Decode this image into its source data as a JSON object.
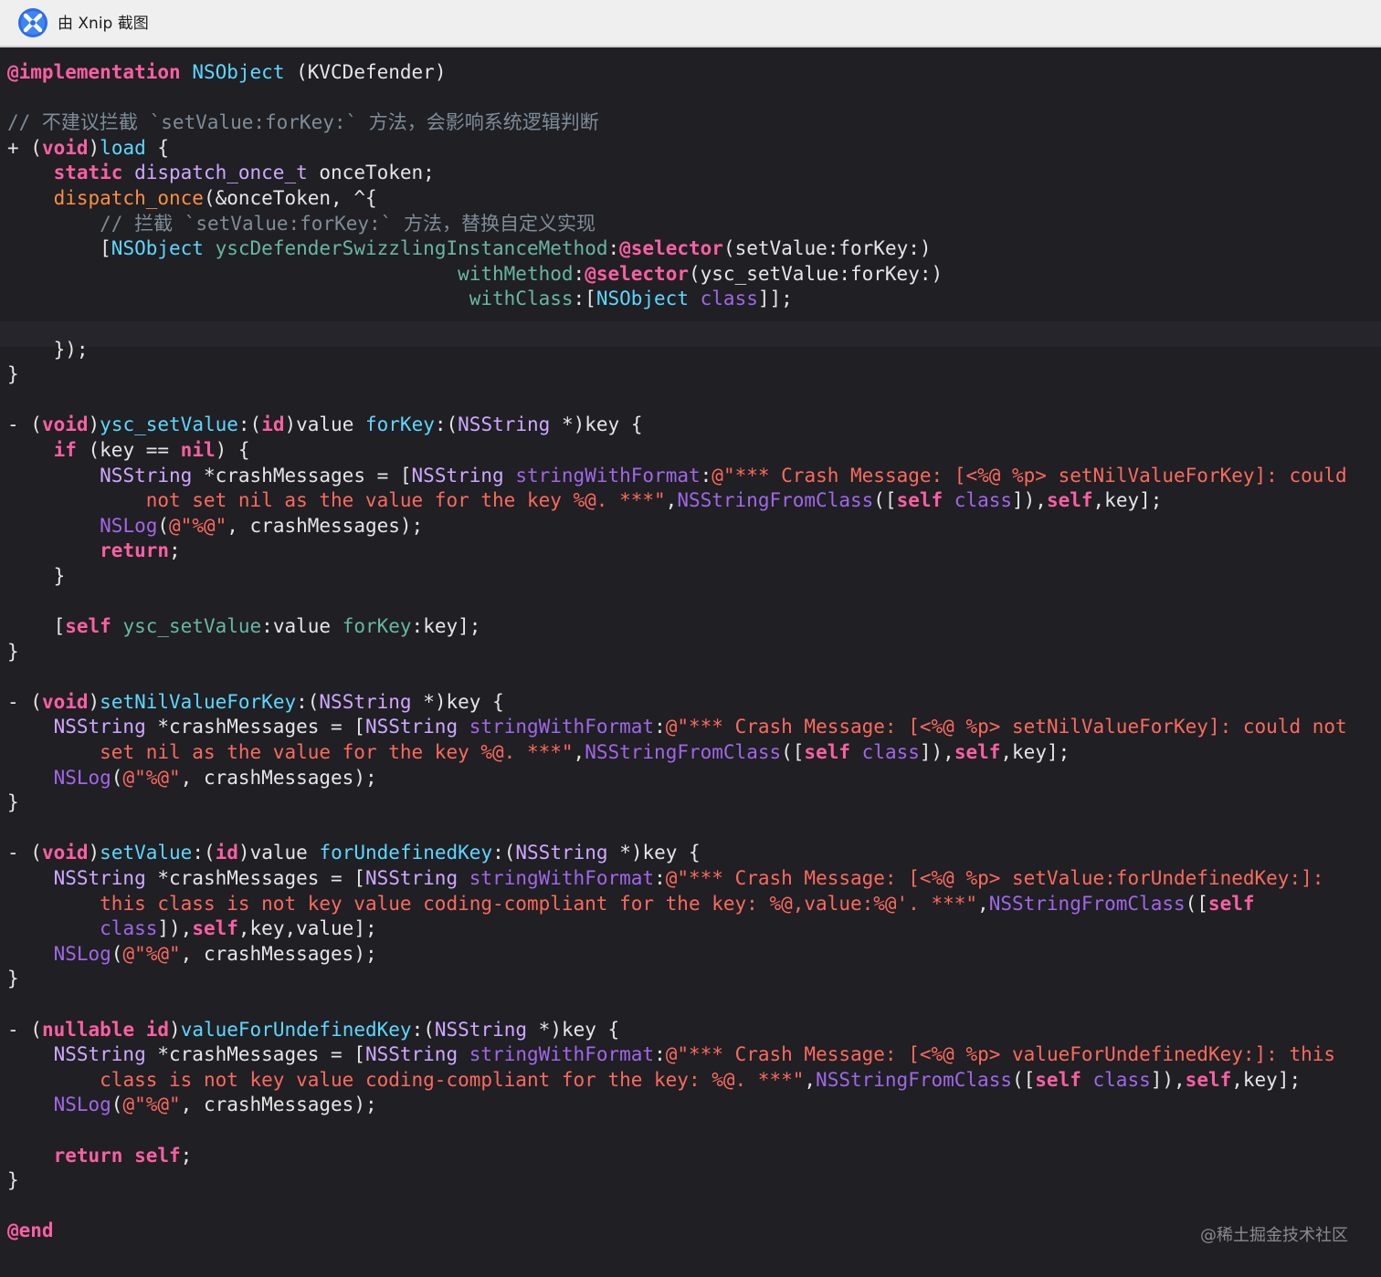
{
  "window": {
    "title": "由 Xnip 截图",
    "app_icon": "xnip-app-icon"
  },
  "editor": {
    "highlighted_line": 12,
    "lines": [
      [
        {
          "t": "@implementation",
          "c": "kw"
        },
        {
          "t": " "
        },
        {
          "t": "NSObject",
          "c": "ty"
        },
        {
          "t": " (KVCDefender)"
        }
      ],
      [],
      [
        {
          "t": "// 不建议拦截 `setValue:forKey:` 方法，会影响系统逻辑判断",
          "c": "cmt"
        }
      ],
      [
        {
          "t": "+ ("
        },
        {
          "t": "void",
          "c": "kw"
        },
        {
          "t": ")"
        },
        {
          "t": "load",
          "c": "ty"
        },
        {
          "t": " {"
        }
      ],
      [
        {
          "t": "    "
        },
        {
          "t": "static",
          "c": "kw"
        },
        {
          "t": " "
        },
        {
          "t": "dispatch_once_t",
          "c": "cls"
        },
        {
          "t": " onceToken;"
        }
      ],
      [
        {
          "t": "    "
        },
        {
          "t": "dispatch_once",
          "c": "mac"
        },
        {
          "t": "(&onceToken, ^{"
        }
      ],
      [
        {
          "t": "        "
        },
        {
          "t": "// 拦截 `setValue:forKey:` 方法，替换自定义实现",
          "c": "cmt"
        }
      ],
      [
        {
          "t": "        ["
        },
        {
          "t": "NSObject",
          "c": "ty"
        },
        {
          "t": " "
        },
        {
          "t": "yscDefenderSwizzlingInstanceMethod",
          "c": "fn"
        },
        {
          "t": ":"
        },
        {
          "t": "@selector",
          "c": "kw"
        },
        {
          "t": "(setValue:forKey:)"
        }
      ],
      [
        {
          "t": "                                       "
        },
        {
          "t": "withMethod",
          "c": "fn"
        },
        {
          "t": ":"
        },
        {
          "t": "@selector",
          "c": "kw"
        },
        {
          "t": "(ysc_setValue:forKey:)"
        }
      ],
      [
        {
          "t": "                                        "
        },
        {
          "t": "withClass",
          "c": "fn"
        },
        {
          "t": ":["
        },
        {
          "t": "NSObject",
          "c": "ty"
        },
        {
          "t": " "
        },
        {
          "t": "class",
          "c": "meth"
        },
        {
          "t": "]];"
        }
      ],
      [],
      [
        {
          "t": "    });"
        }
      ],
      [
        {
          "t": "}"
        }
      ],
      [],
      [
        {
          "t": "- ("
        },
        {
          "t": "void",
          "c": "kw"
        },
        {
          "t": ")"
        },
        {
          "t": "ysc_setValue",
          "c": "ty"
        },
        {
          "t": ":("
        },
        {
          "t": "id",
          "c": "kw"
        },
        {
          "t": ")value "
        },
        {
          "t": "forKey",
          "c": "ty"
        },
        {
          "t": ":("
        },
        {
          "t": "NSString",
          "c": "cls"
        },
        {
          "t": " *)key {"
        }
      ],
      [
        {
          "t": "    "
        },
        {
          "t": "if",
          "c": "kw"
        },
        {
          "t": " (key == "
        },
        {
          "t": "nil",
          "c": "kw"
        },
        {
          "t": ") {"
        }
      ],
      [
        {
          "t": "        "
        },
        {
          "t": "NSString",
          "c": "cls"
        },
        {
          "t": " *crashMessages = ["
        },
        {
          "t": "NSString",
          "c": "cls"
        },
        {
          "t": " "
        },
        {
          "t": "stringWithFormat",
          "c": "meth"
        },
        {
          "t": ":"
        },
        {
          "t": "@\"*** Crash Message: [<%@ %p> setNilValueForKey]: could",
          "c": "str"
        }
      ],
      [
        {
          "t": "            "
        },
        {
          "t": "not set nil as the value for the key %@. ***\"",
          "c": "str"
        },
        {
          "t": ","
        },
        {
          "t": "NSStringFromClass",
          "c": "meth"
        },
        {
          "t": "(["
        },
        {
          "t": "self",
          "c": "kw"
        },
        {
          "t": " "
        },
        {
          "t": "class",
          "c": "meth"
        },
        {
          "t": "]),"
        },
        {
          "t": "self",
          "c": "kw"
        },
        {
          "t": ",key];"
        }
      ],
      [
        {
          "t": "        "
        },
        {
          "t": "NSLog",
          "c": "meth"
        },
        {
          "t": "("
        },
        {
          "t": "@\"%@\"",
          "c": "str"
        },
        {
          "t": ", crashMessages);"
        }
      ],
      [
        {
          "t": "        "
        },
        {
          "t": "return",
          "c": "kw"
        },
        {
          "t": ";"
        }
      ],
      [
        {
          "t": "    }"
        }
      ],
      [],
      [
        {
          "t": "    ["
        },
        {
          "t": "self",
          "c": "kw"
        },
        {
          "t": " "
        },
        {
          "t": "ysc_setValue",
          "c": "fn"
        },
        {
          "t": ":value "
        },
        {
          "t": "forKey",
          "c": "fn"
        },
        {
          "t": ":key];"
        }
      ],
      [
        {
          "t": "}"
        }
      ],
      [],
      [
        {
          "t": "- ("
        },
        {
          "t": "void",
          "c": "kw"
        },
        {
          "t": ")"
        },
        {
          "t": "setNilValueForKey",
          "c": "ty"
        },
        {
          "t": ":("
        },
        {
          "t": "NSString",
          "c": "cls"
        },
        {
          "t": " *)key {"
        }
      ],
      [
        {
          "t": "    "
        },
        {
          "t": "NSString",
          "c": "cls"
        },
        {
          "t": " *crashMessages = ["
        },
        {
          "t": "NSString",
          "c": "cls"
        },
        {
          "t": " "
        },
        {
          "t": "stringWithFormat",
          "c": "meth"
        },
        {
          "t": ":"
        },
        {
          "t": "@\"*** Crash Message: [<%@ %p> setNilValueForKey]: could not",
          "c": "str"
        }
      ],
      [
        {
          "t": "        "
        },
        {
          "t": "set nil as the value for the key %@. ***\"",
          "c": "str"
        },
        {
          "t": ","
        },
        {
          "t": "NSStringFromClass",
          "c": "meth"
        },
        {
          "t": "(["
        },
        {
          "t": "self",
          "c": "kw"
        },
        {
          "t": " "
        },
        {
          "t": "class",
          "c": "meth"
        },
        {
          "t": "]),"
        },
        {
          "t": "self",
          "c": "kw"
        },
        {
          "t": ",key];"
        }
      ],
      [
        {
          "t": "    "
        },
        {
          "t": "NSLog",
          "c": "meth"
        },
        {
          "t": "("
        },
        {
          "t": "@\"%@\"",
          "c": "str"
        },
        {
          "t": ", crashMessages);"
        }
      ],
      [
        {
          "t": "}"
        }
      ],
      [],
      [
        {
          "t": "- ("
        },
        {
          "t": "void",
          "c": "kw"
        },
        {
          "t": ")"
        },
        {
          "t": "setValue",
          "c": "ty"
        },
        {
          "t": ":("
        },
        {
          "t": "id",
          "c": "kw"
        },
        {
          "t": ")value "
        },
        {
          "t": "forUndefinedKey",
          "c": "ty"
        },
        {
          "t": ":("
        },
        {
          "t": "NSString",
          "c": "cls"
        },
        {
          "t": " *)key {"
        }
      ],
      [
        {
          "t": "    "
        },
        {
          "t": "NSString",
          "c": "cls"
        },
        {
          "t": " *crashMessages = ["
        },
        {
          "t": "NSString",
          "c": "cls"
        },
        {
          "t": " "
        },
        {
          "t": "stringWithFormat",
          "c": "meth"
        },
        {
          "t": ":"
        },
        {
          "t": "@\"*** Crash Message: [<%@ %p> setValue:forUndefinedKey:]:",
          "c": "str"
        }
      ],
      [
        {
          "t": "        "
        },
        {
          "t": "this class is not key value coding-compliant for the key: %@,value:%@'. ***\"",
          "c": "str"
        },
        {
          "t": ","
        },
        {
          "t": "NSStringFromClass",
          "c": "meth"
        },
        {
          "t": "(["
        },
        {
          "t": "self",
          "c": "kw"
        }
      ],
      [
        {
          "t": "        "
        },
        {
          "t": "class",
          "c": "meth"
        },
        {
          "t": "]),"
        },
        {
          "t": "self",
          "c": "kw"
        },
        {
          "t": ",key,value];"
        }
      ],
      [
        {
          "t": "    "
        },
        {
          "t": "NSLog",
          "c": "meth"
        },
        {
          "t": "("
        },
        {
          "t": "@\"%@\"",
          "c": "str"
        },
        {
          "t": ", crashMessages);"
        }
      ],
      [
        {
          "t": "}"
        }
      ],
      [],
      [
        {
          "t": "- ("
        },
        {
          "t": "nullable",
          "c": "kw"
        },
        {
          "t": " "
        },
        {
          "t": "id",
          "c": "kw"
        },
        {
          "t": ")"
        },
        {
          "t": "valueForUndefinedKey",
          "c": "ty"
        },
        {
          "t": ":("
        },
        {
          "t": "NSString",
          "c": "cls"
        },
        {
          "t": " *)key {"
        }
      ],
      [
        {
          "t": "    "
        },
        {
          "t": "NSString",
          "c": "cls"
        },
        {
          "t": " *crashMessages = ["
        },
        {
          "t": "NSString",
          "c": "cls"
        },
        {
          "t": " "
        },
        {
          "t": "stringWithFormat",
          "c": "meth"
        },
        {
          "t": ":"
        },
        {
          "t": "@\"*** Crash Message: [<%@ %p> valueForUndefinedKey:]: this",
          "c": "str"
        }
      ],
      [
        {
          "t": "        "
        },
        {
          "t": "class is not key value coding-compliant for the key: %@. ***\"",
          "c": "str"
        },
        {
          "t": ","
        },
        {
          "t": "NSStringFromClass",
          "c": "meth"
        },
        {
          "t": "(["
        },
        {
          "t": "self",
          "c": "kw"
        },
        {
          "t": " "
        },
        {
          "t": "class",
          "c": "meth"
        },
        {
          "t": "]),"
        },
        {
          "t": "self",
          "c": "kw"
        },
        {
          "t": ",key];"
        }
      ],
      [
        {
          "t": "    "
        },
        {
          "t": "NSLog",
          "c": "meth"
        },
        {
          "t": "("
        },
        {
          "t": "@\"%@\"",
          "c": "str"
        },
        {
          "t": ", crashMessages);"
        }
      ],
      [],
      [
        {
          "t": "    "
        },
        {
          "t": "return",
          "c": "kw"
        },
        {
          "t": " "
        },
        {
          "t": "self",
          "c": "kw"
        },
        {
          "t": ";"
        }
      ],
      [
        {
          "t": "}"
        }
      ],
      [],
      [
        {
          "t": "@end",
          "c": "kw"
        }
      ]
    ]
  },
  "watermark": "@稀土掘金技术社区"
}
